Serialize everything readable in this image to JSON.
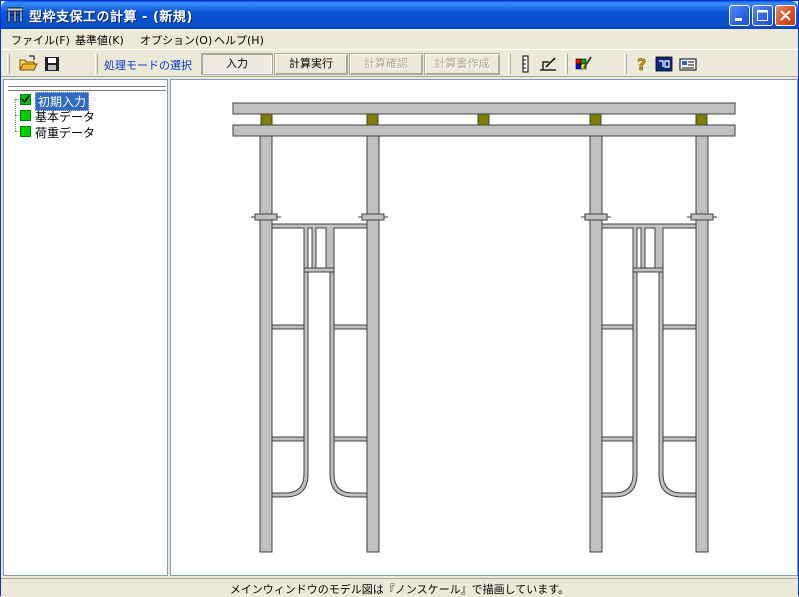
{
  "window": {
    "title": "型枠支保工の計算 - (新規)"
  },
  "menu": {
    "items": [
      {
        "label": "ファイル(F)"
      },
      {
        "label": "基準値(K)"
      },
      {
        "label": "オプション(O)"
      },
      {
        "label": "ヘルプ(H)"
      }
    ]
  },
  "toolbar": {
    "mode_label": "処理モードの選択",
    "buttons": [
      {
        "label": "入力",
        "state": "active"
      },
      {
        "label": "計算実行",
        "state": "normal"
      },
      {
        "label": "計算確認",
        "state": "disabled"
      },
      {
        "label": "計算書作成",
        "state": "disabled"
      }
    ],
    "icons": [
      "open-folder-icon",
      "save-icon",
      "ruler-icon",
      "drawing-icon",
      "palette-icon",
      "help-icon",
      "book-icon",
      "card-icon"
    ]
  },
  "tree": {
    "items": [
      {
        "label": "初期入力",
        "checked": true,
        "selected": true
      },
      {
        "label": "基本データ",
        "checked": false
      },
      {
        "label": "荷重データ",
        "checked": false
      }
    ]
  },
  "status": {
    "text": "メインウィンドウのモデル図は『ノンスケール』で描画しています。"
  },
  "colors": {
    "title_bar": "#0b54d8",
    "frame_fill": "#c0c0c0",
    "frame_stroke": "#404040",
    "pad_fill": "#808000",
    "node_green": "#00d000",
    "mode_label": "#0033cc"
  }
}
